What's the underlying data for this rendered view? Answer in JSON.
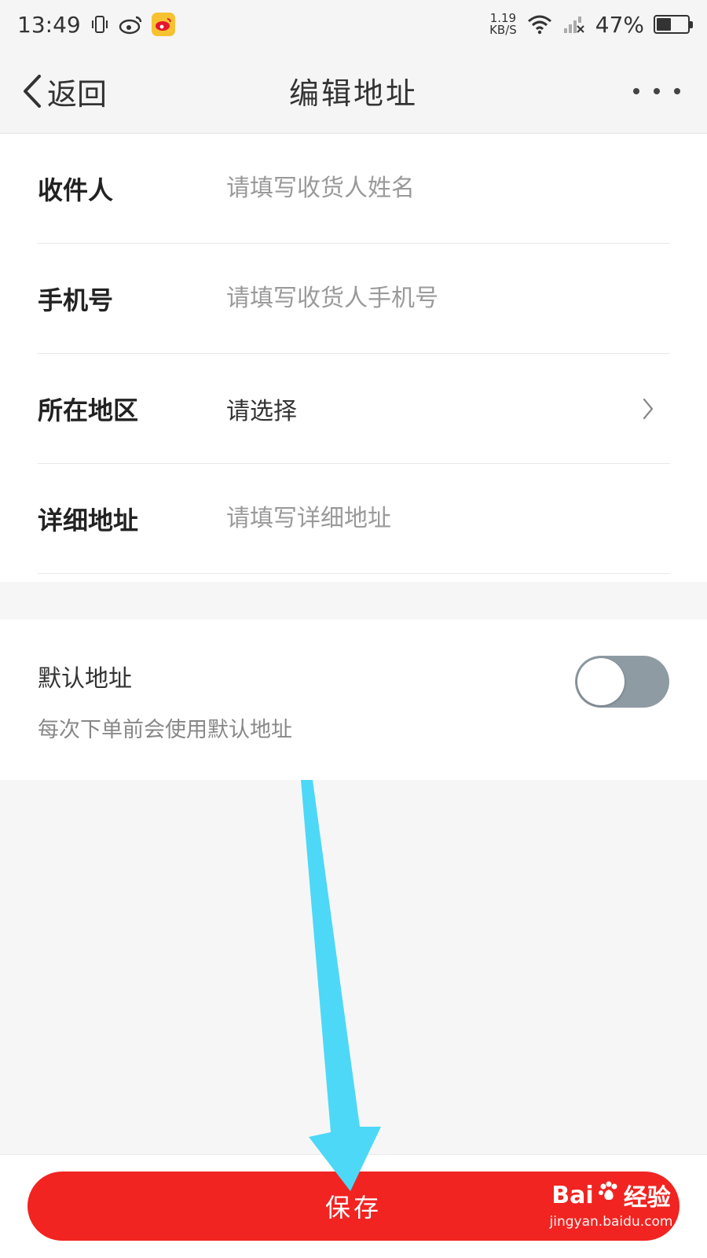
{
  "status_bar": {
    "time": "13:49",
    "net_speed_value": "1.19",
    "net_speed_unit": "KB/S",
    "battery": "47%",
    "battery_level": 0.47,
    "icons": [
      "vibrate-icon",
      "weibo-icon",
      "weibo-app-icon",
      "wifi-icon",
      "signal-icon",
      "battery-icon"
    ]
  },
  "nav": {
    "back_label": "返回",
    "title": "编辑地址",
    "more_icon": "more-icon"
  },
  "form": {
    "rows": [
      {
        "label": "收件人",
        "placeholder": "请填写收货人姓名"
      },
      {
        "label": "手机号",
        "placeholder": "请填写收货人手机号"
      },
      {
        "label": "所在地区",
        "value": "请选择"
      },
      {
        "label": "详细地址",
        "placeholder": "请填写详细地址"
      }
    ]
  },
  "default_address": {
    "title": "默认地址",
    "description": "每次下单前会使用默认地址",
    "enabled": false
  },
  "save_label": "保存",
  "watermark": {
    "logo_text": "Bai",
    "logo_tail": "经验",
    "url": "jingyan.baidu.com"
  },
  "colors": {
    "accent": "#f12421",
    "arrow": "#4dd8f7",
    "toggle_off": "#8e9ba3"
  }
}
